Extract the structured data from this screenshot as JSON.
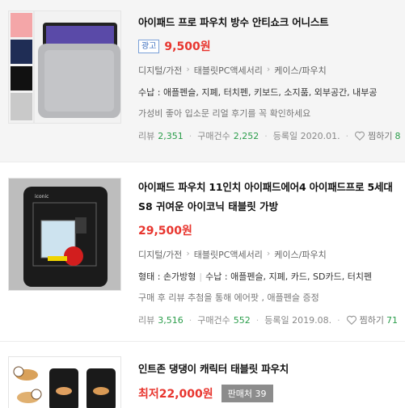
{
  "items": [
    {
      "title": "아이패드 프로 파우치 방수 안티쇼크 어니스트",
      "ad_label": "광고",
      "price": "9,500원",
      "categories": [
        "디지털/가전",
        "태블릿PC액세서리",
        "케이스/파우치"
      ],
      "specs": "수납 : 애플펜슬, 지폐, 터치펜, 키보드, 소지품, 외부공간, 내부공",
      "description": "가성비 좋아 입소문 리얼 후기를 꼭 확인하세요",
      "review_label": "리뷰",
      "review_count": "2,351",
      "purchase_label": "구매건수",
      "purchase_count": "2,252",
      "date_label": "등록일 2020.01.",
      "wish_label": "찜하기",
      "wish_count": "8"
    },
    {
      "title_line1": "아이패드 파우치 11인치 아이패드에어4 아이패드프로 5세대",
      "title_line2": "S8 귀여운 아이코닉 태블릿 가방",
      "price": "29,500원",
      "categories": [
        "디지털/가전",
        "태블릿PC액세서리",
        "케이스/파우치"
      ],
      "spec_type": "형태 : 손가방형",
      "specs": "수납 : 애플펜슬, 지폐, 카드, SD카드, 터치펜",
      "description": "구매 후 리뷰 추첨을 통해 에어팟 , 애플펜슬 증정",
      "review_label": "리뷰",
      "review_count": "3,516",
      "purchase_label": "구매건수",
      "purchase_count": "552",
      "date_label": "등록일 2019.08.",
      "wish_label": "찜하기",
      "wish_count": "71"
    },
    {
      "title": "인트존 댕댕이 캐릭터 태블릿 파우치",
      "price_low": "최저22,000원",
      "seller_badge": "판매처 39"
    }
  ],
  "colors": {
    "price": "#e8352e",
    "count": "#2a9d4a",
    "ad_border": "#7aa0d8"
  }
}
